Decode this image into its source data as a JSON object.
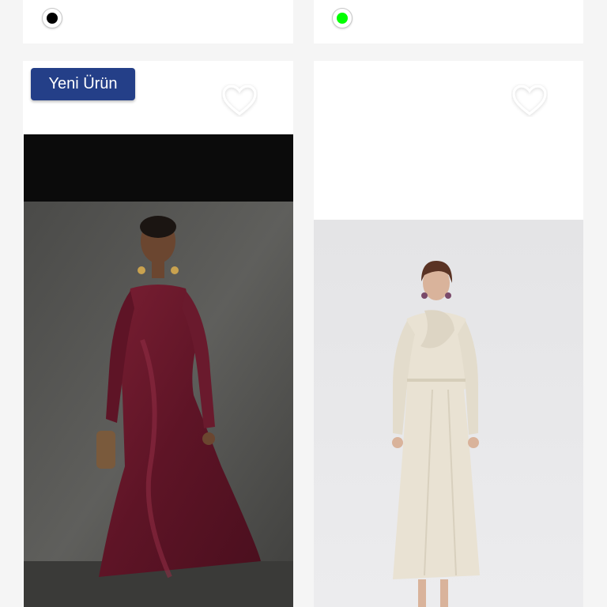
{
  "products": [
    {
      "swatch_color": "#000000",
      "badge": "Yeni Ürün",
      "image_alt": "burgundy-satin-dress"
    },
    {
      "swatch_color": "#00ff00",
      "badge": "",
      "image_alt": "cream-draped-dress"
    }
  ],
  "colors": {
    "badge_bg": "#243f88",
    "burgundy": "#6b1a2c",
    "cream": "#e9e2d3",
    "heart_icon": "heart-outline-icon"
  }
}
